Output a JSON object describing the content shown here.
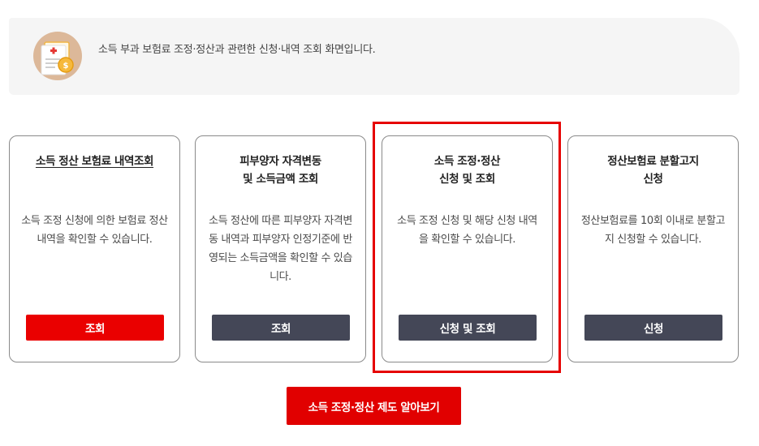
{
  "intro": {
    "text": "소득 부과 보험료 조정·정산과 관련한 신청·내역 조회 화면입니다.",
    "icon": "document-coin-icon"
  },
  "cards": [
    {
      "title_lines": [
        "소득 정산 보험료 내역조회"
      ],
      "description": "소득 조정 신청에 의한 보험료 정산 내역을 확인할 수 있습니다.",
      "button_label": "조회"
    },
    {
      "title_lines": [
        "피부양자 자격변동",
        "및 소득금액 조회"
      ],
      "description": "소득 정산에 따른 피부양자 자격변동 내역과 피부양자 인정기준에 반영되는 소득금액을 확인할 수 있습니다.",
      "button_label": "조회"
    },
    {
      "title_lines": [
        "소득 조정·정산",
        "신청 및 조회"
      ],
      "description": "소득 조정 신청 및 해당 신청 내역을 확인할 수 있습니다.",
      "button_label": "신청 및 조회"
    },
    {
      "title_lines": [
        "정산보험료 분할고지",
        "신청"
      ],
      "description": "정산보험료를 10회 이내로 분할고지 신청할 수 있습니다.",
      "button_label": "신청"
    }
  ],
  "learn_more_label": "소득 조정·정산 제도 알아보기",
  "colors": {
    "accent_red": "#e10000",
    "button_dark": "#444757",
    "highlight": "#e60000",
    "banner_bg": "#f5f5f5"
  }
}
